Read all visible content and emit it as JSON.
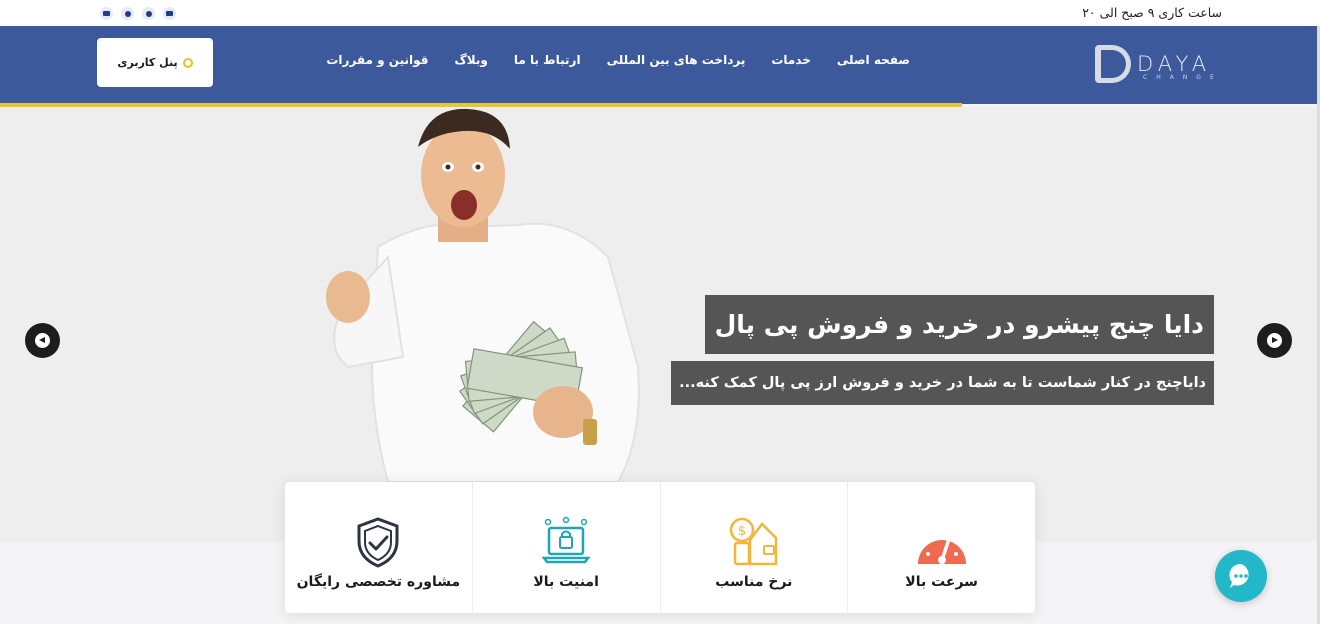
{
  "topbar": {
    "hours": "ساعت کاری ۹ صبح الی ۲۰",
    "social": [
      "youtube-icon",
      "telegram-icon",
      "whatsapp-icon",
      "instagram-icon"
    ]
  },
  "logo": {
    "text": "DAYA",
    "subtext": "CHANGE"
  },
  "nav": {
    "items": [
      {
        "label": "صفحه اصلی"
      },
      {
        "label": "خدمات"
      },
      {
        "label": "پرداخت های بین المللی"
      },
      {
        "label": "ارتباط با ما"
      },
      {
        "label": "وبلاگ"
      },
      {
        "label": "قوانین و مقررات"
      }
    ],
    "panel_label": "پنل کاربری"
  },
  "hero": {
    "title": "دایا چنج پیشرو در خرید و فروش پی پال",
    "subtitle": "دایاچنج در کنار شماست تا به شما در خرید و فروش ارز پی پال کمک کنه..."
  },
  "features": [
    {
      "label": "سرعت بالا",
      "icon": "speedometer-icon"
    },
    {
      "label": "نرخ مناسب",
      "icon": "wallet-coin-icon"
    },
    {
      "label": "امنیت بالا",
      "icon": "secure-laptop-icon"
    },
    {
      "label": "مشاوره تخصصی رایگان",
      "icon": "shield-check-icon"
    }
  ],
  "colors": {
    "navbar": "#3c599b",
    "accent": "#e9c733",
    "chat": "#22b8c9",
    "speed_icon": "#f06a4f",
    "coin_icon": "#f2b63c",
    "secure_icon": "#1fa6b0"
  }
}
